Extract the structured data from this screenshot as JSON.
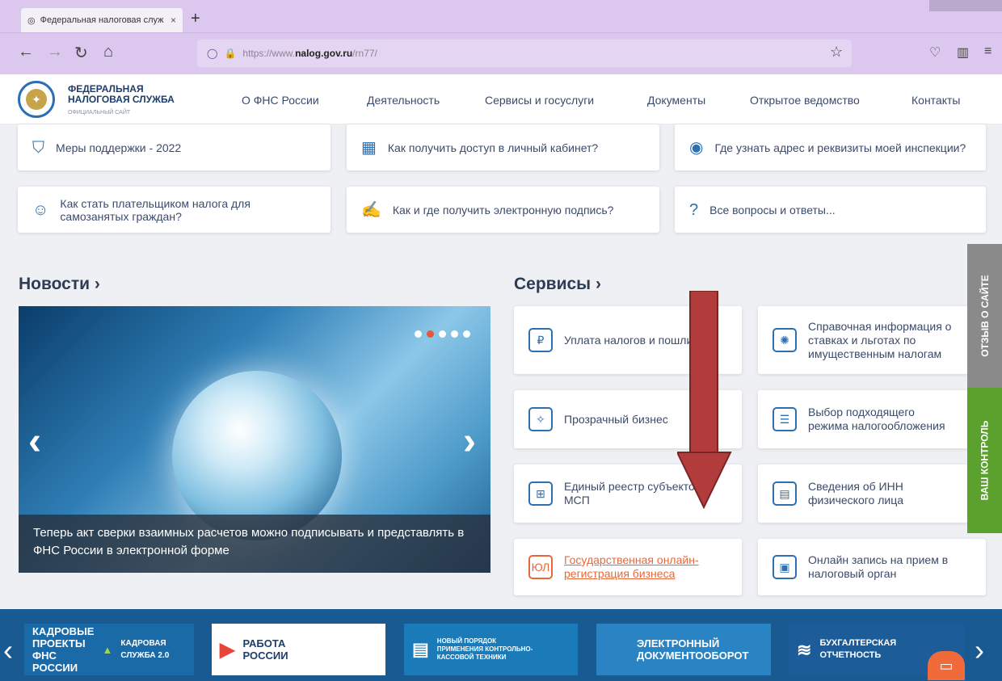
{
  "browser": {
    "tab_title": "Федеральная налоговая служ",
    "tab_close": "×",
    "new_tab": "+",
    "url_prefix": "https://www.",
    "url_host": "nalog.gov.ru",
    "url_path": "/rn77/"
  },
  "site": {
    "logo_line1": "ФЕДЕРАЛЬНАЯ",
    "logo_line2": "НАЛОГОВАЯ СЛУЖБА",
    "logo_sub": "ОФИЦИАЛЬНЫЙ САЙТ",
    "menu": [
      "О ФНС России",
      "Деятельность",
      "Сервисы и госуслуги",
      "Документы",
      "Открытое ведомство",
      "Контакты"
    ]
  },
  "quick": [
    {
      "text": "Меры поддержки - 2022",
      "icon": "shield-icon"
    },
    {
      "text": "Как получить доступ в личный кабинет?",
      "icon": "cabinet-icon"
    },
    {
      "text": "Где узнать адрес и реквизиты моей инспекции?",
      "icon": "emblem-icon"
    },
    {
      "text": "Как стать плательщиком налога для самозанятых граждан?",
      "icon": "people-icon"
    },
    {
      "text": "Как и где получить электронную подпись?",
      "icon": "signature-icon"
    },
    {
      "text": "Все вопросы и ответы...",
      "icon": "question-icon"
    }
  ],
  "news": {
    "heading": "Новости",
    "chevron": "›",
    "caption": "Теперь акт сверки взаимных расчетов можно подписывать и представлять в ФНС России в электронной форме",
    "prev": "‹",
    "next": "›"
  },
  "services": {
    "heading": "Сервисы",
    "chevron": "›",
    "items": [
      "Уплата налогов и пошлин",
      "Справочная информация о ставках и льготах по имущественным налогам",
      "Прозрачный бизнес",
      "Выбор подходящего режима налогообложения",
      "Единый реестр субъектов МСП",
      "Сведения об ИНН физического лица",
      "Государственная онлайн-регистрация бизнеса",
      "Онлайн запись на прием в налоговый орган"
    ]
  },
  "side": {
    "feedback": "ОТЗЫВ О САЙТЕ",
    "control": "ВАШ КОНТРОЛЬ"
  },
  "banners": [
    "КАДРОВЫЕ ПРОЕКТЫ ФНС РОССИИ",
    "КАДРОВАЯ СЛУЖБА 2.0",
    "РАБОТА РОССИИ",
    "НОВЫЙ ПОРЯДОК ПРИМЕНЕНИЯ КОНТРОЛЬНО-КАССОВОЙ ТЕХНИКИ",
    "ЭЛЕКТРОННЫЙ ДОКУМЕНТООБОРОТ",
    "БУХГАЛТЕРСКАЯ ОТЧЕТНОСТЬ"
  ],
  "colors": {
    "accent": "#e8673a",
    "brand": "#1d3d6b",
    "arrow": "#b23b3b",
    "feedback_tab": "#8a8a8a",
    "control_tab": "#5aa12e"
  }
}
